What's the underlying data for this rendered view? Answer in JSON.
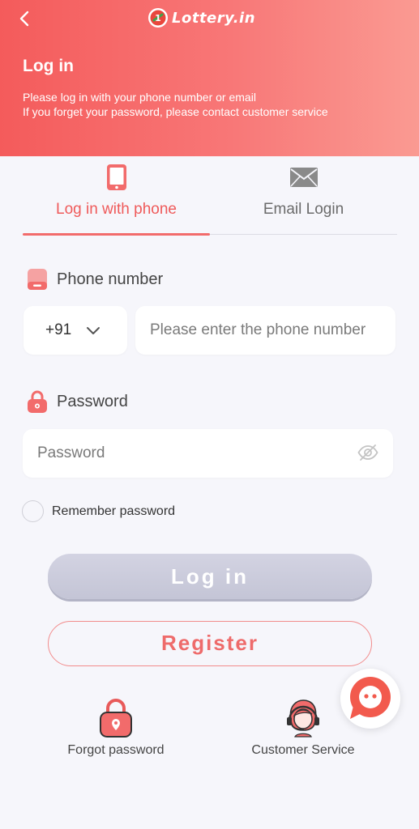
{
  "header": {
    "brand": "Lottery.in",
    "title": "Log in",
    "subtitle_lines": [
      "Please log in with your phone number or email",
      "If you forget your password, please contact customer service"
    ]
  },
  "tabs": [
    {
      "label": "Log in with phone",
      "icon": "phone-icon",
      "active": true
    },
    {
      "label": "Email Login",
      "icon": "envelope-icon",
      "active": false
    }
  ],
  "phone": {
    "label": "Phone number",
    "country_code": "+91",
    "placeholder": "Please enter the phone number"
  },
  "password": {
    "label": "Password",
    "placeholder": "Password"
  },
  "remember_label": "Remember password",
  "buttons": {
    "login": "Log in",
    "register": "Register"
  },
  "bottom_links": {
    "forgot": "Forgot password",
    "service": "Customer Service"
  },
  "colors": {
    "accent": "#ef5a5a",
    "header_gradient_start": "#f45b5b",
    "header_gradient_end": "#fa9a92",
    "disabled_button": "#c9cadb",
    "background": "#f6f6fb"
  }
}
